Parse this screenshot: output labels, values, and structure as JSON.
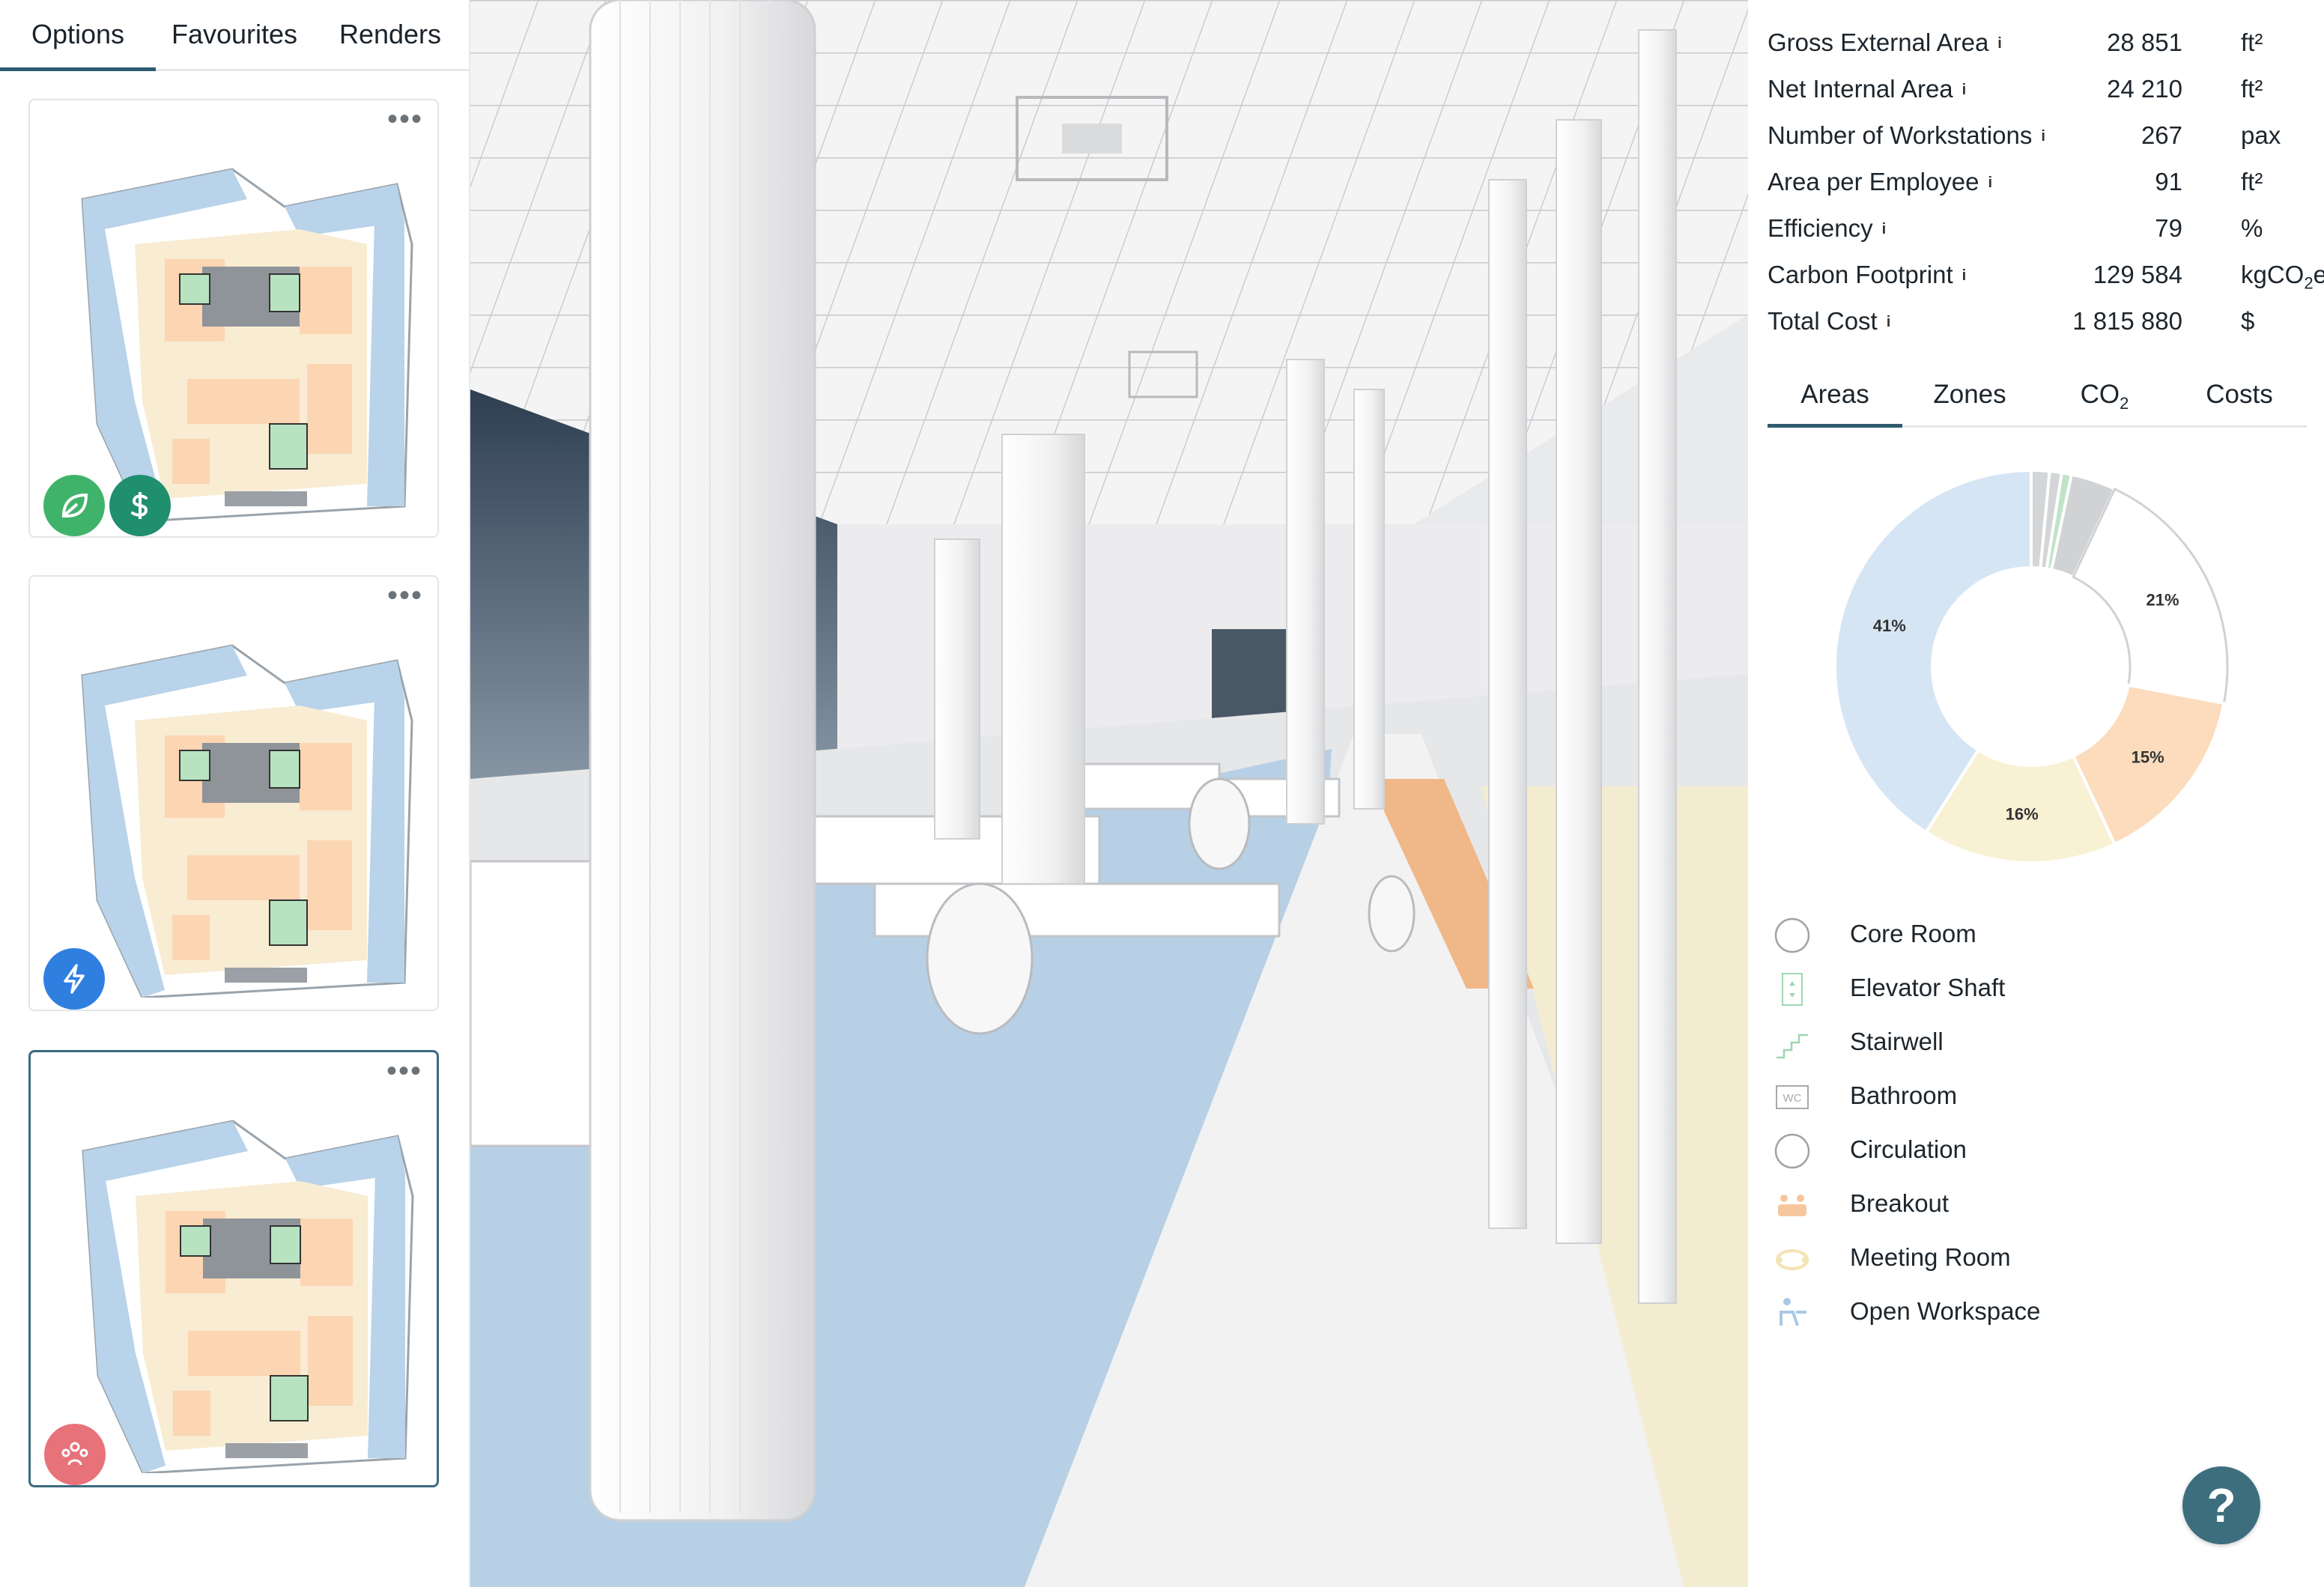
{
  "left_tabs": [
    {
      "label": "Options",
      "active": true
    },
    {
      "label": "Favourites",
      "active": false
    },
    {
      "label": "Renders",
      "active": false
    }
  ],
  "options_cards": [
    {
      "menu": "•••",
      "badges": [
        "leaf-icon",
        "dollar-icon"
      ],
      "selected": false
    },
    {
      "menu": "•••",
      "badges": [
        "lightning-icon"
      ],
      "selected": false
    },
    {
      "menu": "•••",
      "badges": [
        "people-icon"
      ],
      "selected": true
    }
  ],
  "badge_colors": {
    "leaf": "#3fb36a",
    "dollar": "#1f8f6e",
    "lightning": "#2f7fe0",
    "people": "#e8727a"
  },
  "metrics": [
    {
      "label": "Gross External Area",
      "value": "28 851",
      "unit": "ft²"
    },
    {
      "label": "Net Internal Area",
      "value": "24 210",
      "unit": "ft²"
    },
    {
      "label": "Number of Workstations",
      "value": "267",
      "unit": "pax"
    },
    {
      "label": "Area per Employee",
      "value": "91",
      "unit": "ft²"
    },
    {
      "label": "Efficiency",
      "value": "79",
      "unit": "%"
    },
    {
      "label": "Carbon Footprint",
      "value": "129 584",
      "unit_main": "kgCO",
      "unit_sub": "2",
      "unit_tail": "e"
    },
    {
      "label": "Total Cost",
      "value": "1 815 880",
      "unit": "$"
    }
  ],
  "info_symbol": "i",
  "right_tabs": [
    {
      "label": "Areas",
      "active": true
    },
    {
      "label": "Zones",
      "active": false
    },
    {
      "label_main": "CO",
      "label_sub": "2",
      "active": false
    },
    {
      "label": "Costs",
      "active": false
    }
  ],
  "chart_data": {
    "type": "pie",
    "categories": [
      "Core Room",
      "Elevator Shaft",
      "Stairwell",
      "Bathroom",
      "Circulation",
      "Breakout",
      "Meeting Room",
      "Open Workspace"
    ],
    "values": [
      1.5,
      1,
      0.8,
      3.7,
      21,
      15,
      16,
      41
    ],
    "labels": [
      "",
      "",
      "",
      "",
      "21%",
      "15%",
      "16%",
      "41%"
    ],
    "colors": [
      "#d3d5d7",
      "#d3d5d7",
      "#bfe3c8",
      "#d0d2d4",
      "#ffffff",
      "#fcdcbd",
      "#f8f1d4",
      "#d6e5f4"
    ]
  },
  "legend": [
    {
      "label": "Core Room",
      "icon": "circle-outline-icon"
    },
    {
      "label": "Elevator Shaft",
      "icon": "elevator-icon"
    },
    {
      "label": "Stairwell",
      "icon": "stairs-icon"
    },
    {
      "label": "Bathroom",
      "icon": "wc-icon"
    },
    {
      "label": "Circulation",
      "icon": "circle-outline-icon"
    },
    {
      "label": "Breakout",
      "icon": "breakout-icon"
    },
    {
      "label": "Meeting Room",
      "icon": "meeting-icon"
    },
    {
      "label": "Open Workspace",
      "icon": "workspace-icon"
    }
  ],
  "help": {
    "label": "?"
  }
}
